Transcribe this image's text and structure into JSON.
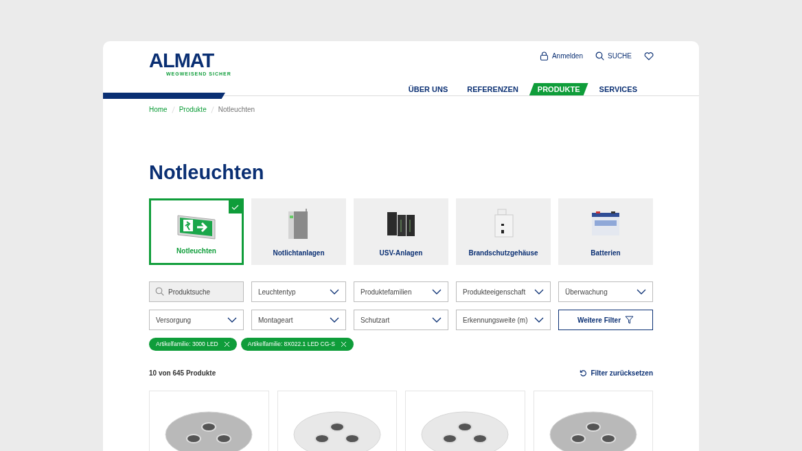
{
  "logo": {
    "name": "ALMAT",
    "tagline": "WEGWEISEND SICHER"
  },
  "top_links": [
    {
      "kind": "login",
      "label": "Anmelden"
    },
    {
      "kind": "search",
      "label": "SUCHE"
    },
    {
      "kind": "favorites"
    }
  ],
  "nav": [
    {
      "label": "ÜBER UNS",
      "selected": false
    },
    {
      "label": "REFERENZEN",
      "selected": false
    },
    {
      "label": "PRODUKTE",
      "selected": true
    },
    {
      "label": "SERVICES",
      "selected": false
    }
  ],
  "breadcrumb": [
    {
      "label": "Home",
      "current": false
    },
    {
      "label": "Produkte",
      "current": false
    },
    {
      "label": "Notleuchten",
      "current": true
    }
  ],
  "title": "Notleuchten",
  "categories": [
    {
      "label": "Notleuchten",
      "kind": "exit-sign",
      "selected": true
    },
    {
      "label": "Notlichtanlagen",
      "kind": "cabinet",
      "selected": false
    },
    {
      "label": "USV-Anlagen",
      "kind": "ups",
      "selected": false
    },
    {
      "label": "Brandschutzgehäuse",
      "kind": "housing",
      "selected": false
    },
    {
      "label": "Batterien",
      "kind": "battery",
      "selected": false
    }
  ],
  "filters": [
    {
      "kind": "search",
      "placeholder": "Produktsuche"
    },
    {
      "kind": "dropdown",
      "label": "Leuchtentyp"
    },
    {
      "kind": "dropdown",
      "label": "Produktefamilien"
    },
    {
      "kind": "dropdown",
      "label": "Produkteeigenschaft"
    },
    {
      "kind": "dropdown",
      "label": "Überwachung"
    },
    {
      "kind": "dropdown",
      "label": "Versorgung"
    },
    {
      "kind": "dropdown",
      "label": "Montageart"
    },
    {
      "kind": "dropdown",
      "label": "Schutzart"
    },
    {
      "kind": "dropdown",
      "label": "Erkennungsweite (m)"
    },
    {
      "kind": "button",
      "label": "Weitere Filter"
    }
  ],
  "active_filters": [
    "Artikelfamilie: 3000 LED",
    "Artikelfamilie: 8X022.1 LED CG-S"
  ],
  "result_count": "10 von 645 Produkte",
  "reset_label": "Filter zurücksetzen",
  "products": [
    {
      "color": "#b9b9b9"
    },
    {
      "color": "#e8e8e8"
    },
    {
      "color": "#e8e8e8"
    },
    {
      "color": "#b9b9b9"
    }
  ]
}
